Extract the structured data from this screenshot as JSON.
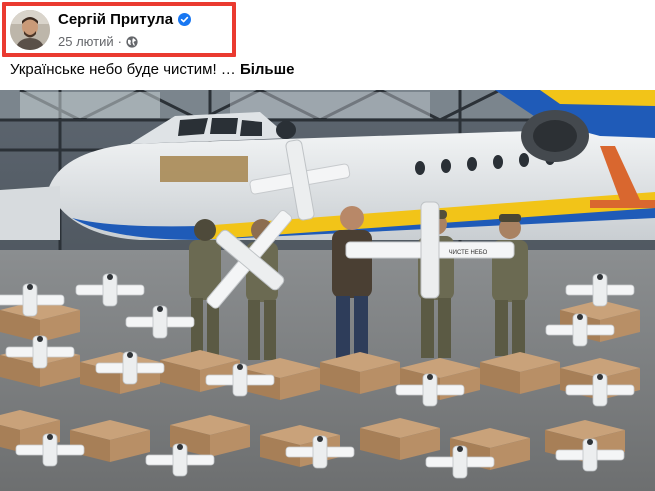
{
  "post": {
    "author": "Сергій Притула",
    "date": "25 лютий",
    "meta_separator": "·",
    "text": "Українське небо буде чистим! … ",
    "see_more": "Більше"
  },
  "icons": {
    "verified": "verified-badge-icon",
    "audience": "globe-icon"
  },
  "colors": {
    "highlight": "#ea3a30",
    "verified": "#1877f2",
    "meta": "#65676b"
  },
  "photo": {
    "drone_label": "ЧИСТЕ НЕБО"
  }
}
